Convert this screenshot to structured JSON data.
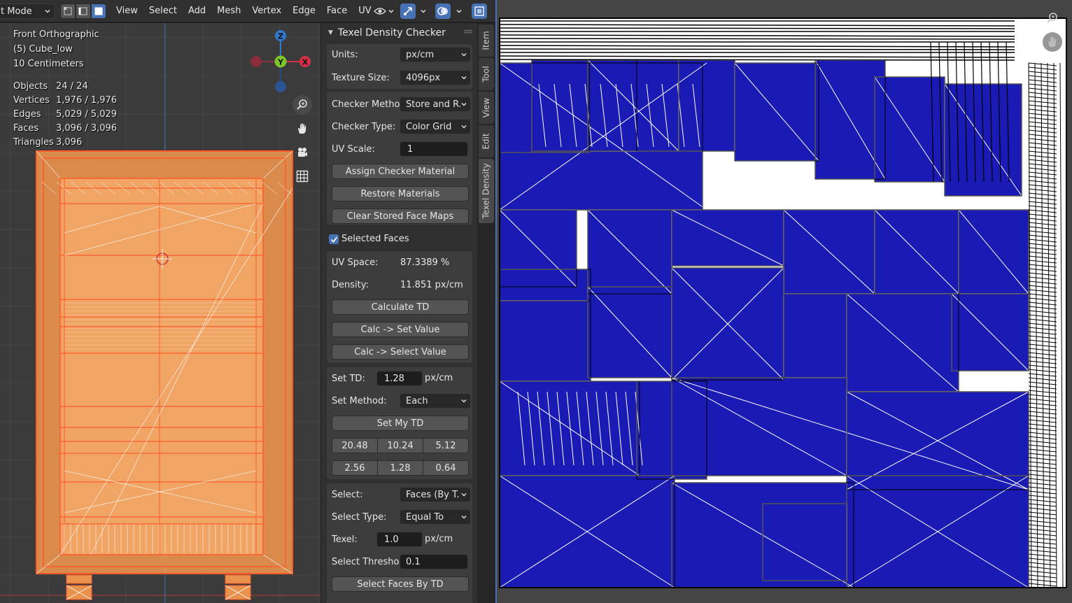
{
  "header": {
    "mode": "t Mode",
    "menus": [
      "View",
      "Select",
      "Add",
      "Mesh",
      "Vertex",
      "Edge",
      "Face",
      "UV"
    ]
  },
  "viewport": {
    "view_name": "Front Orthographic",
    "object_name": "(5) Cube_low",
    "scale": "10 Centimeters",
    "stats": [
      {
        "label": "Objects",
        "value": "24 / 24"
      },
      {
        "label": "Vertices",
        "value": "1,976 / 1,976"
      },
      {
        "label": "Edges",
        "value": "5,029 / 5,029"
      },
      {
        "label": "Faces",
        "value": "3,096 / 3,096"
      },
      {
        "label": "Triangles",
        "value": "3,096"
      }
    ],
    "gizmo": {
      "z": "Z",
      "y": "Y",
      "x": "X"
    }
  },
  "panel": {
    "title": "Texel Density Checker",
    "units_label": "Units:",
    "units_value": "px/cm",
    "texture_size_label": "Texture Size:",
    "texture_size_value": "4096px",
    "checker_method_label": "Checker Method:",
    "checker_method_value": "Store and R...",
    "checker_type_label": "Checker Type:",
    "checker_type_value": "Color Grid",
    "uv_scale_label": "UV Scale:",
    "uv_scale_value": "1",
    "assign_checker": "Assign Checker Material",
    "restore_materials": "Restore Materials",
    "clear_face_maps": "Clear Stored Face Maps",
    "selected_faces_label": "Selected Faces",
    "selected_faces_checked": true,
    "uv_space_label": "UV Space:",
    "uv_space_value": "87.3389 %",
    "density_label": "Density:",
    "density_value": "11.851 px/cm",
    "calculate_td": "Calculate TD",
    "calc_set_value": "Calc -> Set Value",
    "calc_select_value": "Calc -> Select Value",
    "set_td_label": "Set TD:",
    "set_td_value": "1.28",
    "set_td_unit": "px/cm",
    "set_method_label": "Set Method:",
    "set_method_value": "Each",
    "set_my_td": "Set My TD",
    "presets": [
      "20.48",
      "10.24",
      "5.12",
      "2.56",
      "1.28",
      "0.64"
    ],
    "select_label": "Select:",
    "select_value": "Faces (By T...",
    "select_type_label": "Select Type:",
    "select_type_value": "Equal To",
    "texel_label": "Texel:",
    "texel_value": "1.0",
    "texel_unit": "px/cm",
    "select_threshold_label": "Select Threshold:",
    "select_threshold_value": "0.1",
    "select_faces_by_td": "Select Faces By TD"
  },
  "tabs": [
    "Item",
    "Tool",
    "View",
    "Edit",
    "Texel Density"
  ],
  "colors": {
    "accent": "#4772b3",
    "uv_fill": "#1a1ab4",
    "mesh_orange": "#e8924e",
    "mesh_wire": "#ff5a2a"
  }
}
